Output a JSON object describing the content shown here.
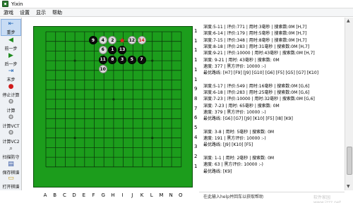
{
  "window": {
    "title": "Yixin"
  },
  "menu": [
    "游戏",
    "设置",
    "显示",
    "帮助"
  ],
  "toolbar": [
    {
      "label": "重步",
      "icon": "undo-all-icon",
      "active": true
    },
    {
      "label": "前一步",
      "icon": "prev-icon"
    },
    {
      "label": "后一步",
      "icon": "next-icon"
    },
    {
      "label": "末步",
      "icon": "last-icon"
    },
    {
      "label": "停止计算",
      "icon": "stop-icon"
    },
    {
      "label": "计算",
      "icon": "compute-icon"
    },
    {
      "label": "计算VCT",
      "icon": "vct-icon"
    },
    {
      "label": "计算VC2",
      "icon": "vc2-icon"
    },
    {
      "label": "扫描防守",
      "icon": "scan-defense-icon"
    },
    {
      "label": "保存棋谱",
      "icon": "save-icon"
    },
    {
      "label": "打开棋谱",
      "icon": "open-icon"
    }
  ],
  "board": {
    "columns": [
      "A",
      "B",
      "C",
      "D",
      "E",
      "F",
      "G",
      "H",
      "I",
      "J",
      "K",
      "L",
      "M",
      "N",
      "O"
    ],
    "rows": [
      "15",
      "14",
      "13",
      "12",
      "11",
      "10",
      "9",
      "8",
      "7",
      "6",
      "5",
      "4",
      "3",
      "2",
      "1"
    ],
    "stones": [
      {
        "label": "9",
        "color": "black",
        "col": 5,
        "row": 13
      },
      {
        "label": "4",
        "color": "white",
        "col": 6,
        "row": 13
      },
      {
        "label": "2",
        "color": "white",
        "col": 7,
        "row": 13
      },
      {
        "label": "12",
        "color": "white",
        "col": 9,
        "row": 13
      },
      {
        "label": "14",
        "color": "white",
        "col": 10,
        "row": 13,
        "last": true
      },
      {
        "label": "6",
        "color": "white",
        "col": 6,
        "row": 12
      },
      {
        "label": "1",
        "color": "black",
        "col": 7,
        "row": 12
      },
      {
        "label": "13",
        "color": "black",
        "col": 8,
        "row": 12
      },
      {
        "label": "11",
        "color": "black",
        "col": 6,
        "row": 11
      },
      {
        "label": "8",
        "color": "black",
        "col": 7,
        "row": 11
      },
      {
        "label": "3",
        "color": "black",
        "col": 8,
        "row": 11
      },
      {
        "label": "5",
        "color": "black",
        "col": 9,
        "row": 11
      },
      {
        "label": "7",
        "color": "black",
        "col": 10,
        "row": 11
      },
      {
        "label": "10",
        "color": "white",
        "col": 6,
        "row": 10
      }
    ],
    "marker": {
      "col": 8,
      "row": 13,
      "symbol": "★"
    }
  },
  "info_lines": [
    "深度:5-11 | 评价:771 | 用时:3毫秒 | 搜索数:0M [H,7]",
    "深度:6-14 | 评价:179 | 用时:5毫秒 | 搜索数:0M [H,7]",
    "深度:7-15 | 评价:348 | 用时:8毫秒 | 搜索数:0M [H,7]",
    "深度:8-18 | 评价:283 | 用时:31毫秒 | 搜索数:0M [H,7]",
    "深度:9-21 | 评价:10000 | 用时:43毫秒 | 搜索数:0M [H,7]",
    "深度: 9-21 | 用时: 43毫秒 | 搜索数: 0M",
    "速度: 377 | 黑方评价: 10000 :-)",
    "最优路线: [H7] [F9] [J9] [G10] [G6] [F5] [G5] [G7] [K10]",
    "",
    "深度:5-17 | 评价:549 | 用时:16毫秒 | 搜索数:0M [G,6]",
    "深度:6-18 | 评价:283 | 用时:25毫秒 | 搜索数:0M [G,6]",
    "深度:7-23 | 评价:10000 | 用时:32毫秒 | 搜索数:0M [G,6]",
    "深度: 7-23 | 用时: 65毫秒 | 搜索数: 0M",
    "速度: 379 | 黑方评价: 10000 :-)",
    "最优路线: [G6] [G7] [J9] [K10] [F5] [I8] [K9]",
    "",
    "深度: 3-8 | 用时: 5毫秒 | 搜索数: 0M",
    "速度: 191 | 黑方评价: 10000 :-)",
    "最优路线: [J9] [K10] [F5]",
    "",
    "深度: 1-1 | 用时: 2毫秒 | 搜索数: 0M",
    "速度: 63 | 黑方评价: 10000 :-)",
    "最优路线: [K9]"
  ],
  "command_hint": "在此输入help并回车以获取帮助",
  "watermark": "软件家园 www.jzzz.net"
}
